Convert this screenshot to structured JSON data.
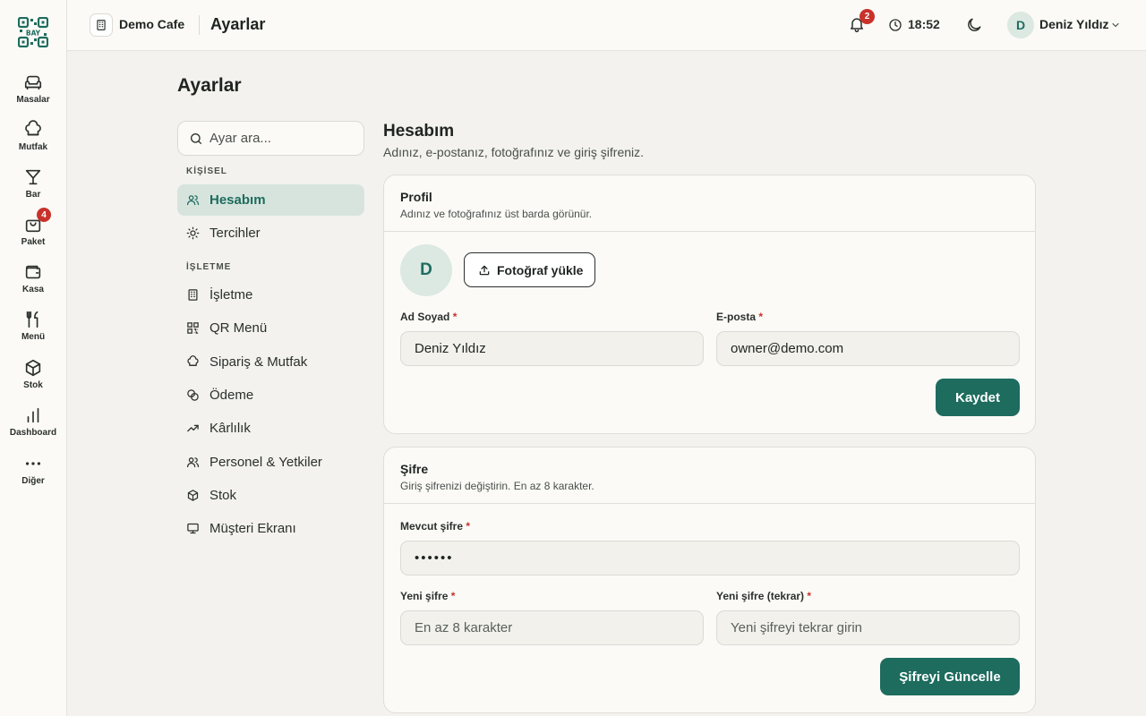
{
  "rail": {
    "logo_text": "BAY",
    "items": [
      {
        "label": "Masalar"
      },
      {
        "label": "Mutfak"
      },
      {
        "label": "Bar"
      },
      {
        "label": "Paket",
        "badge": "4"
      },
      {
        "label": "Kasa"
      },
      {
        "label": "Menü"
      },
      {
        "label": "Stok"
      },
      {
        "label": "Dashboard"
      },
      {
        "label": "Diğer"
      }
    ]
  },
  "topbar": {
    "cafe_name": "Demo Cafe",
    "page": "Ayarlar",
    "notification_count": "2",
    "time": "18:52",
    "user_initial": "D",
    "user_name": "Deniz Yıldız"
  },
  "page_title": "Ayarlar",
  "search": {
    "placeholder": "Ayar ara..."
  },
  "nav": {
    "group_personal": "KİŞİSEL",
    "group_business": "İŞLETME",
    "items": [
      {
        "label": "Hesabım"
      },
      {
        "label": "Tercihler"
      },
      {
        "label": "İşletme"
      },
      {
        "label": "QR Menü"
      },
      {
        "label": "Sipariş & Mutfak"
      },
      {
        "label": "Ödeme"
      },
      {
        "label": "Kârlılık"
      },
      {
        "label": "Personel & Yetkiler"
      },
      {
        "label": "Stok"
      },
      {
        "label": "Müşteri Ekranı"
      }
    ]
  },
  "section": {
    "title": "Hesabım",
    "subtitle": "Adınız, e-postanız, fotoğrafınız ve giriş şifreniz."
  },
  "profile": {
    "title": "Profil",
    "desc": "Adınız ve fotoğrafınız üst barda görünür.",
    "avatar_initial": "D",
    "upload_label": "Fotoğraf yükle",
    "name_label": "Ad Soyad",
    "name_value": "Deniz Yıldız",
    "email_label": "E-posta",
    "email_value": "owner@demo.com",
    "required_mark": "*",
    "save_label": "Kaydet"
  },
  "password": {
    "title": "Şifre",
    "desc": "Giriş şifrenizi değiştirin. En az 8 karakter.",
    "current_label": "Mevcut şifre",
    "current_value": "••••••",
    "new_label": "Yeni şifre",
    "new_placeholder": "En az 8 karakter",
    "repeat_label": "Yeni şifre (tekrar)",
    "repeat_placeholder": "Yeni şifreyi tekrar girin",
    "required_mark": "*",
    "update_label": "Şifreyi Güncelle"
  },
  "colors": {
    "accent": "#1d6c5e",
    "accent_soft": "#d7e4dd",
    "badge": "#c8322b",
    "background": "#f3f2ee"
  }
}
